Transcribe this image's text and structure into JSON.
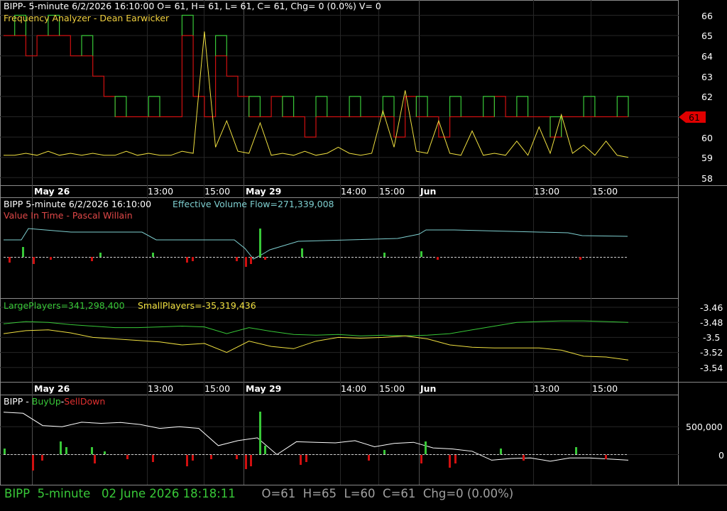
{
  "colors": {
    "bg": "#000000",
    "grid": "#303030",
    "border": "#8a8a8a",
    "red": "#d01010",
    "green": "#38c838",
    "yellow": "#f0e040",
    "cyan": "#7ecfd0",
    "white": "#ffffff",
    "tag": "#e00000"
  },
  "panels": {
    "price": {
      "header": "BIPP- 5-minute 6/2/2026 16:10:00 O= 61, H= 61, L= 61, C= 61, Chg= 0 (0.0%) V= 0",
      "indicator": "Frequency Analyzer - Dean Earwicker",
      "y_ticks": [
        "66",
        "65",
        "64",
        "63",
        "62",
        "61",
        "60",
        "59",
        "58"
      ],
      "last_tag": "61"
    },
    "volume": {
      "header": "BIPP 5-minute  6/2/2026 16:10:00",
      "flow": "Effective Volume Flow=271,339,008",
      "indicator": "Value In Time - Pascal Willain"
    },
    "players": {
      "large": "LargePlayers=341,298,400",
      "small": "SmallPlayers=-35,319,436",
      "y_ticks": [
        "-3.46",
        "-3.48",
        "-3.5",
        "-3.52",
        "-3.54"
      ]
    },
    "buysell": {
      "symbol": "BIPP - ",
      "buy": "BuyUp",
      "dash": "-",
      "sell": "SellDown",
      "y_ticks": [
        "500,000",
        "0"
      ]
    }
  },
  "time_axis": {
    "labels": [
      "May 26",
      "13:00",
      "15:00",
      "May 29",
      "14:00",
      "15:00",
      "Jun",
      "13:00",
      "15:00"
    ]
  },
  "status": {
    "symbol": "BIPP",
    "interval": "5-minute",
    "datetime": "02 June 2026 18:18:11",
    "open": "O=61",
    "high": "H=65",
    "low": "L=60",
    "close": "C=61",
    "change": "Chg=0 (0.00%)"
  },
  "chart_data": {
    "type": "line",
    "sessions": [
      "May 26",
      "May 29",
      "Jun"
    ],
    "price_ylim": [
      58,
      66
    ],
    "price_steps": [
      65,
      65,
      64,
      65,
      65,
      65,
      64,
      64,
      63,
      62,
      61,
      61,
      61,
      61,
      61,
      61,
      65,
      62,
      61,
      64,
      63,
      62,
      61,
      61,
      62,
      61,
      61,
      60,
      61,
      61,
      61,
      61,
      61,
      61,
      61,
      60,
      62,
      61,
      61,
      60,
      61,
      61,
      61,
      61,
      62,
      61,
      61,
      61,
      61,
      60,
      61,
      61,
      61,
      61,
      61,
      61,
      61
    ],
    "freq_series": [
      59.1,
      59.1,
      59.2,
      59.1,
      59.3,
      59.1,
      59.2,
      59.1,
      59.2,
      59.1,
      59.1,
      59.3,
      59.1,
      59.2,
      59.1,
      59.1,
      59.3,
      59.2,
      65.2,
      59.5,
      60.8,
      59.3,
      59.2,
      60.7,
      59.1,
      59.2,
      59.1,
      59.3,
      59.1,
      59.2,
      59.5,
      59.2,
      59.1,
      59.2,
      61.3,
      59.5,
      62.3,
      59.3,
      59.2,
      60.8,
      59.2,
      59.1,
      60.3,
      59.1,
      59.2,
      59.1,
      59.8,
      59.1,
      60.5,
      59.2,
      61.1,
      59.2,
      59.6,
      59.1,
      59.8,
      59.1,
      59.0
    ],
    "players_ylim": [
      -3.55,
      -3.45
    ],
    "large_players": [
      -3.482,
      -3.479,
      -3.48,
      -3.483,
      -3.485,
      -3.487,
      -3.487,
      -3.486,
      -3.485,
      -3.486,
      -3.495,
      -3.487,
      -3.492,
      -3.496,
      -3.497,
      -3.496,
      -3.498,
      -3.497,
      -3.498,
      -3.497,
      -3.495,
      -3.49,
      -3.485,
      -3.48,
      -3.479,
      -3.478,
      -3.478,
      -3.479,
      -3.48
    ],
    "small_players": [
      -3.495,
      -3.491,
      -3.49,
      -3.494,
      -3.5,
      -3.502,
      -3.504,
      -3.506,
      -3.51,
      -3.508,
      -3.52,
      -3.505,
      -3.512,
      -3.515,
      -3.505,
      -3.5,
      -3.501,
      -3.5,
      -3.498,
      -3.502,
      -3.51,
      -3.513,
      -3.514,
      -3.514,
      -3.514,
      -3.517,
      -3.525,
      -3.526,
      -3.53
    ],
    "buysell_ylim": [
      -150000,
      1000000
    ],
    "buysell_line": [
      760000,
      740000,
      520000,
      500000,
      580000,
      560000,
      575000,
      540000,
      470000,
      500000,
      470000,
      160000,
      250000,
      300000,
      0,
      230000,
      220000,
      210000,
      250000,
      140000,
      200000,
      220000,
      120000,
      100000,
      60000,
      -100000,
      -70000,
      -60000,
      -120000,
      -60000,
      -60000,
      -80000,
      -100000
    ]
  }
}
